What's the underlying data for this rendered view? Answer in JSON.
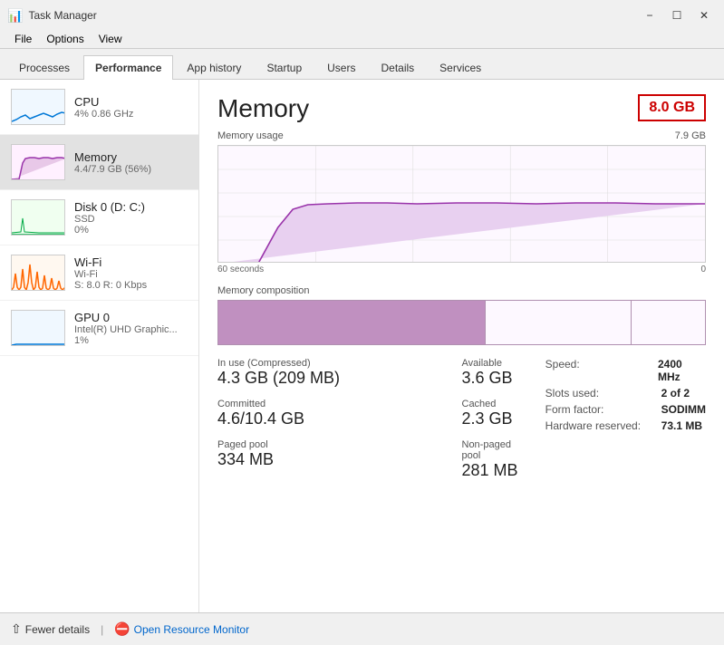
{
  "window": {
    "title": "Task Manager",
    "icon": "⚙"
  },
  "menu": {
    "items": [
      "File",
      "Options",
      "View"
    ]
  },
  "tabs": {
    "items": [
      {
        "label": "Processes",
        "active": false
      },
      {
        "label": "Performance",
        "active": true
      },
      {
        "label": "App history",
        "active": false
      },
      {
        "label": "Startup",
        "active": false
      },
      {
        "label": "Users",
        "active": false
      },
      {
        "label": "Details",
        "active": false
      },
      {
        "label": "Services",
        "active": false
      }
    ]
  },
  "sidebar": {
    "items": [
      {
        "id": "cpu",
        "title": "CPU",
        "sub1": "4% 0.86 GHz",
        "sub2": "",
        "selected": false,
        "color": "#0078d7"
      },
      {
        "id": "memory",
        "title": "Memory",
        "sub1": "4.4/7.9 GB (56%)",
        "sub2": "",
        "selected": true,
        "color": "#9933aa"
      },
      {
        "id": "disk",
        "title": "Disk 0 (D: C:)",
        "sub1": "SSD",
        "sub2": "0%",
        "selected": false,
        "color": "#00aa44"
      },
      {
        "id": "wifi",
        "title": "Wi-Fi",
        "sub1": "Wi-Fi",
        "sub2": "S: 8.0  R: 0 Kbps",
        "selected": false,
        "color": "#ff6600"
      },
      {
        "id": "gpu",
        "title": "GPU 0",
        "sub1": "Intel(R) UHD Graphic...",
        "sub2": "1%",
        "selected": false,
        "color": "#0078d7"
      }
    ]
  },
  "detail": {
    "title": "Memory",
    "badge": "8.0 GB",
    "chart": {
      "label": "Memory usage",
      "max_label": "7.9 GB",
      "time_left": "60 seconds",
      "time_right": "0"
    },
    "composition": {
      "label": "Memory composition"
    },
    "stats": {
      "in_use_label": "In use (Compressed)",
      "in_use_value": "4.3 GB (209 MB)",
      "available_label": "Available",
      "available_value": "3.6 GB",
      "committed_label": "Committed",
      "committed_value": "4.6/10.4 GB",
      "cached_label": "Cached",
      "cached_value": "2.3 GB",
      "paged_label": "Paged pool",
      "paged_value": "334 MB",
      "nonpaged_label": "Non-paged pool",
      "nonpaged_value": "281 MB"
    },
    "specs": {
      "speed_label": "Speed:",
      "speed_value": "2400 MHz",
      "slots_label": "Slots used:",
      "slots_value": "2 of 2",
      "form_label": "Form factor:",
      "form_value": "SODIMM",
      "hardware_label": "Hardware reserved:",
      "hardware_value": "73.1 MB"
    }
  },
  "footer": {
    "fewer_details": "Fewer details",
    "divider": "|",
    "open_resource": "Open Resource Monitor"
  }
}
